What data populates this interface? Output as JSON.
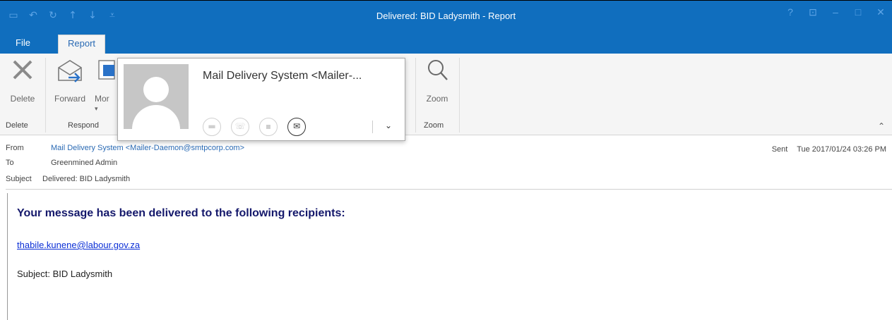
{
  "window": {
    "title": "Delivered: BID Ladysmith - Report",
    "controls": [
      "?",
      "⊡",
      "–",
      "□",
      "✕"
    ]
  },
  "quick_access": [
    "save-icon",
    "undo-icon",
    "redo-icon",
    "up-arrow-icon",
    "down-arrow-icon",
    "customize-icon"
  ],
  "tabs": [
    {
      "label": "File",
      "active": false
    },
    {
      "label": "Report",
      "active": true
    }
  ],
  "ribbon": {
    "delete_label": "Delete",
    "forward_label": "Forward",
    "more_label": "Mor",
    "zoom_label": "Zoom",
    "groups": {
      "delete": "Delete",
      "respond": "Respond",
      "zoom": "Zoom"
    }
  },
  "header": {
    "from_key": "From",
    "from_value": "Mail Delivery System <Mailer-Daemon@smtpcorp.com>",
    "to_key": "To",
    "to_value": "Greenmined Admin",
    "subject_key": "Subject",
    "subject_value": "Delivered: BID Ladysmith",
    "sent_key": "Sent",
    "sent_value": "Tue 2017/01/24 03:26 PM"
  },
  "body": {
    "heading": "Your message has been delivered to the following recipients:",
    "recipient": "thabile.kunene@labour.gov.za",
    "subject_line": "Subject: BID Ladysmith"
  },
  "contact_card": {
    "name": "Mail Delivery System <Mailer-...",
    "icons": [
      "chat-icon",
      "call-icon",
      "video-icon",
      "email-icon"
    ]
  },
  "colors": {
    "title_bar": "#106ebe",
    "link": "#0b2fd6",
    "heading": "#14186b"
  }
}
